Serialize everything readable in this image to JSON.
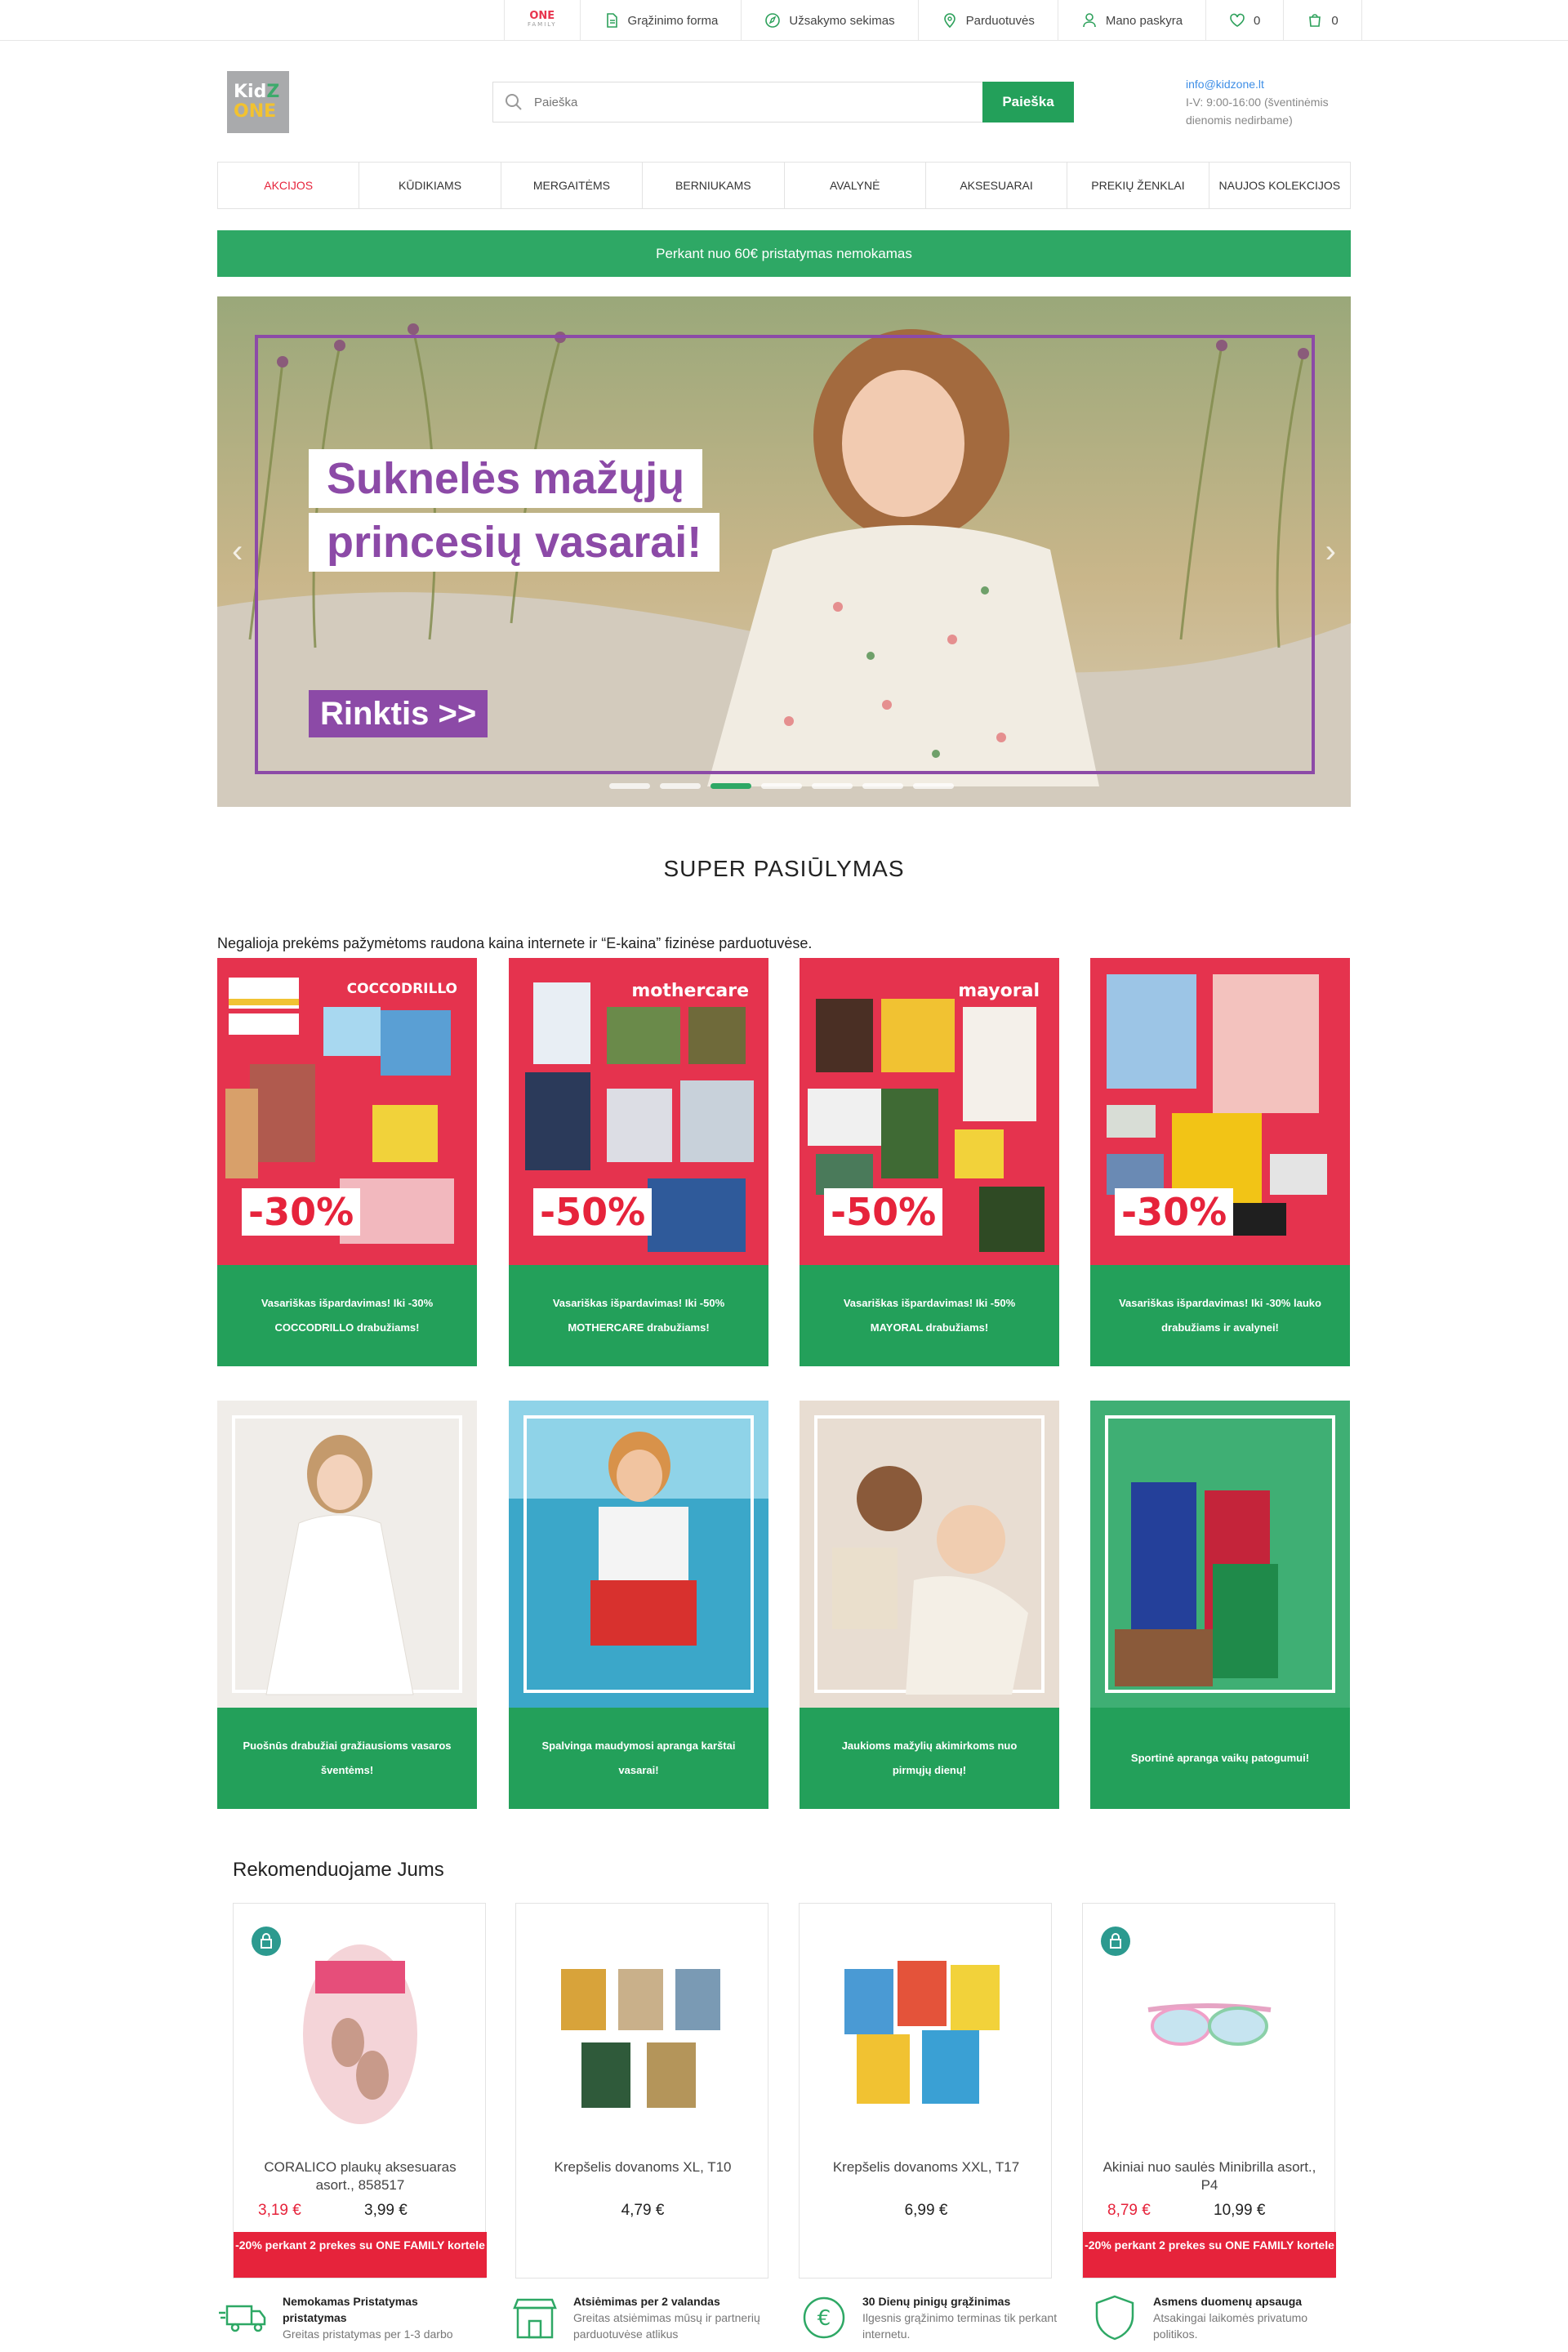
{
  "topbar": {
    "onefamily_logo": "ONE",
    "onefamily_sub": "FAMILY",
    "return_form": "Grąžinimo forma",
    "order_tracking": "Užsakymo sekimas",
    "stores": "Parduotuvės",
    "account": "Mano paskyra",
    "wishlist_count": "0",
    "cart_count": "0"
  },
  "header": {
    "logo_line1_a": "Kid",
    "logo_line1_b": "Z",
    "logo_line2": "ONE",
    "search_placeholder": "Paieška",
    "search_button": "Paieška",
    "contact_email": "info@kidzone.lt",
    "contact_hours": "I-V: 9:00-16:00 (šventinėmis dienomis nedirbame)"
  },
  "nav": {
    "items": [
      "Akcijos",
      "Kūdikiams",
      "Mergaitėms",
      "Berniukams",
      "Avalynė",
      "Aksesuarai",
      "Prekių ženklai",
      "Naujos kolekcijos"
    ]
  },
  "promo_bar": "Perkant nuo 60€ pristatymas nemokamas",
  "hero": {
    "title_line1": "Suknelės mažųjų",
    "title_line2": "princesių vasarai!",
    "cta": "Rinktis >>",
    "prev_icon": "‹",
    "next_icon": "›"
  },
  "offers": {
    "title": "SUPER PASIŪLYMAS",
    "notice": "Negalioja prekėms pažymėtoms raudona kaina internete ir “E-kaina” fizinėse parduotuvėse.",
    "cards": [
      {
        "brand": "COCCODRILLO",
        "discount": "-30%",
        "caption": "Vasariškas išpardavimas! Iki -30% COCCODRILLO drabužiams!"
      },
      {
        "brand": "mothercare",
        "discount": "-50%",
        "caption": "Vasariškas išpardavimas! Iki -50% MOTHERCARE drabužiams!"
      },
      {
        "brand": "mayoral",
        "discount": "-50%",
        "caption": "Vasariškas išpardavimas! Iki -50% MAYORAL drabužiams!"
      },
      {
        "brand": "",
        "discount": "-30%",
        "caption": "Vasariškas išpardavimas! Iki -30% lauko drabužiams ir avalynei!"
      },
      {
        "caption": "Puošnūs drabužiai gražiausioms vasaros šventėms!"
      },
      {
        "caption": "Spalvinga maudymosi apranga karštai vasarai!"
      },
      {
        "caption": "Jaukioms mažylių akimirkoms nuo pirmųjų dienų!"
      },
      {
        "caption": "Sportinė apranga vaikų patogumui!"
      }
    ]
  },
  "recommend": {
    "title": "Rekomenduojame Jums",
    "products": [
      {
        "name": "CORALICO plaukų aksesuaras asort., 858517",
        "price_sale": "3,19 €",
        "price": "3,99 €",
        "promo": "-20% perkant 2 prekes su ONE FAMILY kortele"
      },
      {
        "name": "Krepšelis dovanoms XL, T10",
        "price": "4,79 €"
      },
      {
        "name": "Krepšelis dovanoms XXL, T17",
        "price": "6,99 €"
      },
      {
        "name": "Akiniai nuo saulės Minibrilla asort., P4",
        "price_sale": "8,79 €",
        "price": "10,99 €",
        "promo": "-20% perkant 2 prekes su ONE FAMILY kortele"
      }
    ]
  },
  "features": [
    {
      "title": "Nemokamas Pristatymas pristatymas",
      "text": "Greitas pristatymas per 1-3 darbo"
    },
    {
      "title": "Atsiėmimas per 2 valandas",
      "text": "Greitas atsiėmimas mūsų ir partnerių parduotuvėse atlikus"
    },
    {
      "title": "30 Dienų pinigų grąžinimas",
      "text": "Ilgesnis grąžinimo terminas tik perkant internetu."
    },
    {
      "title": "Asmens duomenų apsauga",
      "text": "Atsakingai laikomės privatumo politikos."
    }
  ],
  "colors": {
    "brand_green": "#23a05a",
    "sale_red": "#e6233b",
    "hero_purple": "#8c4aa7"
  }
}
